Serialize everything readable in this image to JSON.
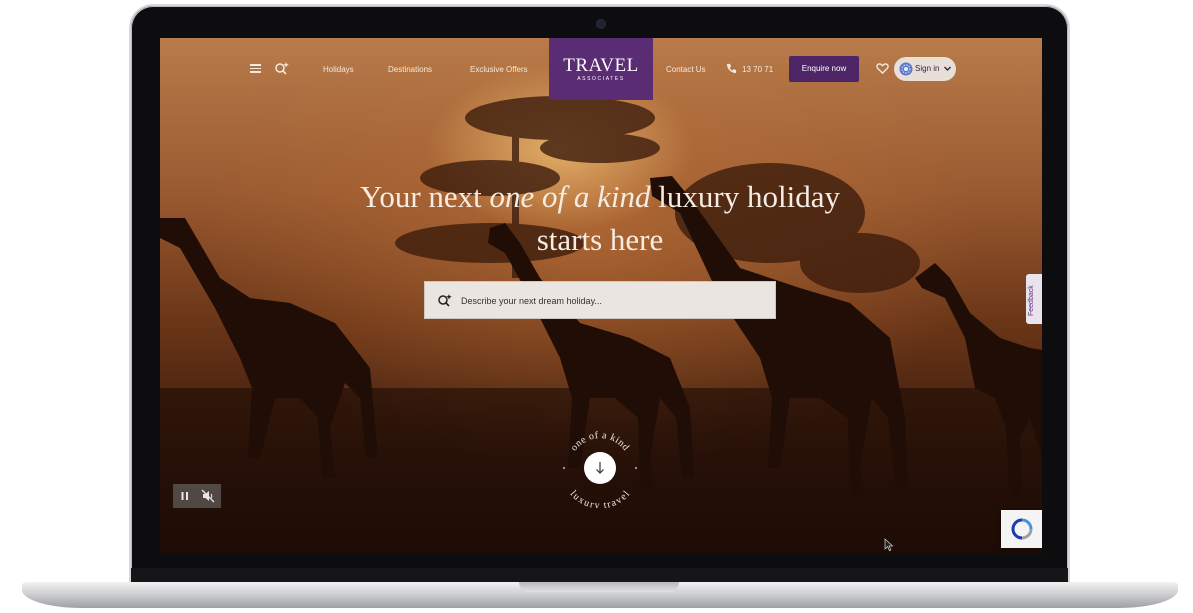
{
  "nav": {
    "holidays": "Holidays",
    "destinations": "Destinations",
    "exclusive_offers": "Exclusive Offers",
    "contact_us": "Contact Us",
    "phone": "13 70 71",
    "enquire": "Enquire now",
    "sign_in": "Sign in"
  },
  "logo": {
    "word": "TRAVEL",
    "sub": "ASSOCIATES"
  },
  "hero": {
    "headline_part1": "Your next ",
    "headline_emphasis": "one of a kind",
    "headline_part2": " luxury holiday",
    "headline_line2": "starts here",
    "search_placeholder": "Describe your next dream holiday..."
  },
  "badge": {
    "top_text": "one of a kind",
    "bottom_text": "luxury travel"
  },
  "feedback": "Feedback",
  "icons": {
    "menu": "hamburger-menu-icon",
    "search": "sparkle-search-icon",
    "phone": "phone-icon",
    "heart": "heart-icon",
    "avatar": "user-avatar-icon",
    "chevron": "chevron-down-icon",
    "pause": "pause-icon",
    "mute": "speaker-muted-icon",
    "arrow": "arrow-down-icon",
    "recaptcha": "recaptcha-icon",
    "cursor": "mouse-cursor-icon"
  },
  "colors": {
    "brand_purple": "#5a2c74",
    "button_purple": "#4d2567",
    "hero_text": "#f6ece2"
  }
}
